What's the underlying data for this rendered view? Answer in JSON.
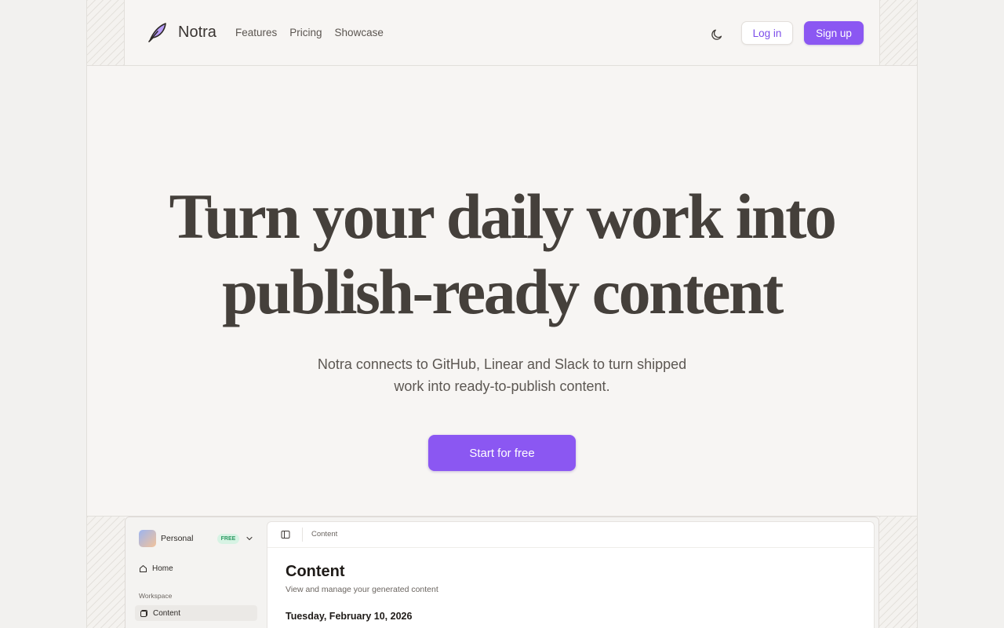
{
  "header": {
    "brand": "Notra",
    "nav": [
      "Features",
      "Pricing",
      "Showcase"
    ],
    "login_label": "Log in",
    "signup_label": "Sign up",
    "theme_icon": "moon-icon"
  },
  "hero": {
    "title_line1": "Turn your daily work into",
    "title_line2": "publish-ready content",
    "subtitle_line1": "Notra connects to GitHub, Linear and Slack to turn shipped",
    "subtitle_line2": "work into ready-to-publish content.",
    "cta_label": "Start for free"
  },
  "preview": {
    "workspace_name": "Personal",
    "workspace_badge": "FREE",
    "sidebar": {
      "home_label": "Home",
      "section_label": "Workspace",
      "content_label": "Content"
    },
    "main": {
      "breadcrumb": "Content",
      "title": "Content",
      "description": "View and manage your generated content",
      "date": "Tuesday, February 10, 2026"
    }
  },
  "colors": {
    "accent": "#8b57f2",
    "background": "#f7f5f3",
    "text": "#45403b"
  }
}
